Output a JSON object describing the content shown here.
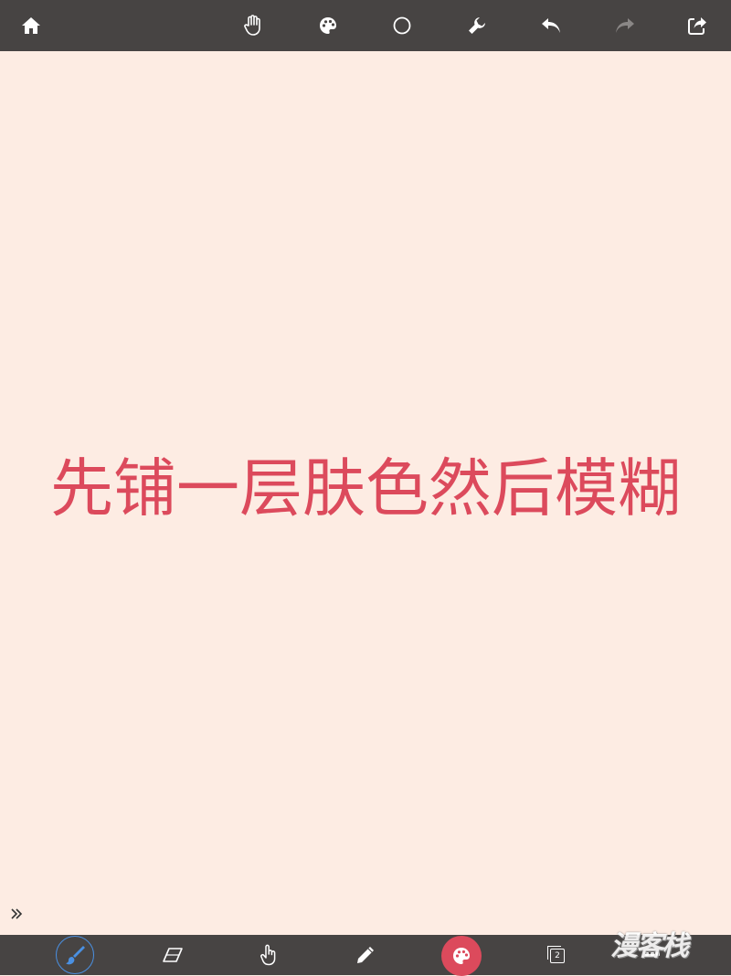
{
  "toolbar_top": {
    "icons": [
      "home-icon",
      "hand-icon",
      "palette-icon",
      "circle-icon",
      "wrench-icon",
      "undo-icon",
      "redo-icon",
      "share-icon"
    ]
  },
  "canvas": {
    "text": "先铺一层肤色然后模糊",
    "text_color": "#dc4a5c",
    "background_color": "#fdece3"
  },
  "toolbar_bottom": {
    "icons": [
      "brush-icon",
      "eraser-icon",
      "finger-icon",
      "pencil-icon",
      "palette-icon",
      "layers-icon",
      "more-icon"
    ],
    "active_tool": "brush-icon",
    "layer_count": "2",
    "accent_color": "#4a90e2",
    "color_button_color": "#dc4a5c"
  },
  "watermark": "漫客栈"
}
